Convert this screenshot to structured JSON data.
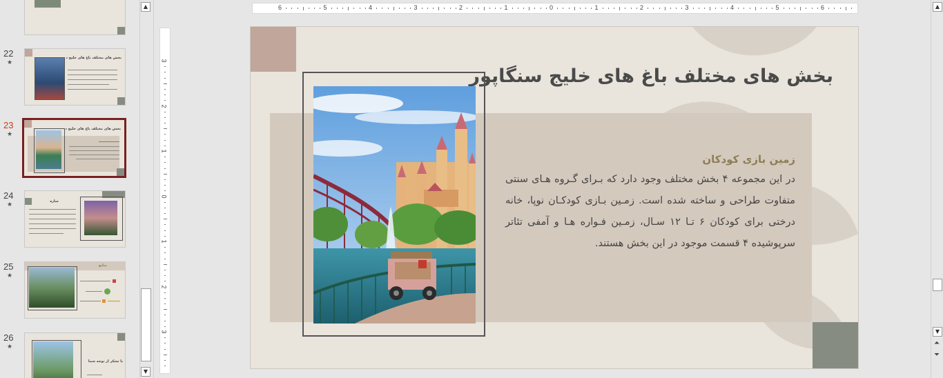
{
  "thumbnails": [
    {
      "number": "22",
      "star": "★",
      "title": "بخش های مختلف باغ های خلیج سنگاپور"
    },
    {
      "number": "23",
      "star": "★",
      "title": "بخش های مختلف باغ های خلیج سنگاپور",
      "selected": true
    },
    {
      "number": "24",
      "star": "★",
      "title": "سازه"
    },
    {
      "number": "25",
      "star": "★",
      "title": "منابع"
    },
    {
      "number": "26",
      "star": "★",
      "title": "با تشکر از توجه شما"
    }
  ],
  "ruler": {
    "h_numbers": [
      "6",
      "5",
      "4",
      "3",
      "2",
      "1",
      "0",
      "1",
      "2",
      "3",
      "4",
      "5",
      "6"
    ],
    "v_numbers": [
      "3",
      "2",
      "1",
      "0",
      "1",
      "2",
      "3"
    ]
  },
  "slide": {
    "title": "بخش های مختلف باغ های خلیج سنگاپور",
    "subheading": "زمین بازی کودکان",
    "body": "در این مجموعه ۴ بخش مختلف وجود دارد که بـرای گـروه هـای سنتی متفاوت طراحی و ساخته شده است. زمـین بـازی کودکـان نوپا، خانه درختی برای کودکان ۶ تـا ۱۲ سـال، زمـین فـواره هـا و آمفی تئاتر سرپوشیده ۴ قسمت موجود در این بخش هستند.",
    "image_description_icon": "castle-photo"
  },
  "colors": {
    "slide_bg": "#e9e4dc",
    "panel_bg": "#d4c9bd",
    "corner_top": "#c0a69b",
    "corner_bottom": "#878c83",
    "subheading": "#8d7e56",
    "selected_border": "#7a1f1f",
    "active_number": "#c43e1c"
  }
}
